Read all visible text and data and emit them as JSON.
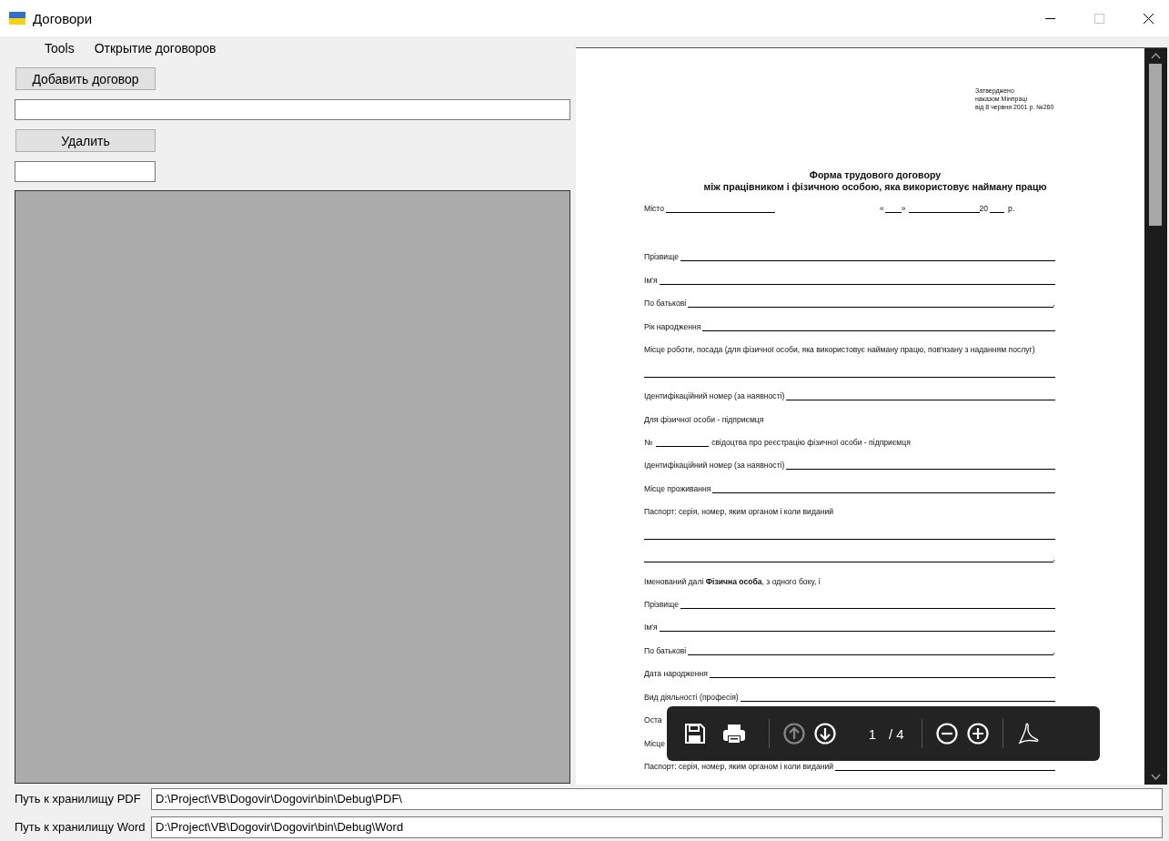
{
  "window": {
    "title": "Договори",
    "maximize_disabled": true
  },
  "menu": [
    "Tools",
    "Открытие договоров"
  ],
  "left_panel": {
    "add_button": "Добавить договор",
    "delete_button": "Удалить"
  },
  "pdf_viewer": {
    "header": [
      "Затверджено",
      "наказом Мінпраці",
      "від 8 червня 2001 р. №260"
    ],
    "title": [
      "Форма трудового договору",
      "між працівником і фізичною особою, яка використовує найману працю"
    ],
    "date_row": {
      "city_label": "Місто",
      "day_open": "«",
      "day_close": "»",
      "year_prefix": "20",
      "year_suffix": "р."
    },
    "rows": [
      {
        "kind": "field",
        "label": "Прізвище"
      },
      {
        "kind": "field",
        "label": "Ім'я"
      },
      {
        "kind": "field",
        "label": "По батькові",
        "trailing": ","
      },
      {
        "kind": "field",
        "label": "Рік народження"
      },
      {
        "kind": "text",
        "text": "Місце роботи, посада (для фізичної особи, яка використовує найману працю, пов'язану з наданням послуг)"
      },
      {
        "kind": "blank"
      },
      {
        "kind": "field",
        "label": "Ідентифікаційний номер (за наявності)"
      },
      {
        "kind": "text",
        "text": "Для фізичної особи - підприємця"
      },
      {
        "kind": "number",
        "label": "№",
        "text": "свідоцтва про реєстрацію фізичної особи - підприємця"
      },
      {
        "kind": "field",
        "label": "Ідентифікаційний номер (за наявності)"
      },
      {
        "kind": "field",
        "label": "Місце проживання"
      },
      {
        "kind": "text",
        "text": "Паспорт: серія, номер, яким органом і коли виданий"
      },
      {
        "kind": "blank"
      },
      {
        "kind": "blank",
        "trailing": ","
      },
      {
        "kind": "text",
        "text": "Іменований далі **Фізична особа**, з одного боку, і"
      },
      {
        "kind": "field",
        "label": "Прізвище"
      },
      {
        "kind": "field",
        "label": "Ім'я"
      },
      {
        "kind": "field",
        "label": "По батькові",
        "trailing": ","
      },
      {
        "kind": "field",
        "label": "Дата народження"
      },
      {
        "kind": "field",
        "label": "Вид діяльності (професія)"
      },
      {
        "kind": "text",
        "text": "Оста"
      },
      {
        "kind": "text",
        "text": "Місце"
      },
      {
        "kind": "field",
        "label": "Паспорт: серія, номер, яким органом і коли виданий"
      }
    ],
    "toolbar": {
      "page": "1",
      "page_count": "/ 4",
      "previous_disabled": true,
      "next_disabled": false
    }
  },
  "paths": [
    {
      "label": "Путь к хранилищу PDF",
      "value": "D:\\Project\\VB\\Dogovir\\Dogovir\\bin\\Debug\\PDF\\"
    },
    {
      "label": "Путь к хранилищу Word",
      "value": "D:\\Project\\VB\\Dogovir\\Dogovir\\bin\\Debug\\Word"
    }
  ]
}
